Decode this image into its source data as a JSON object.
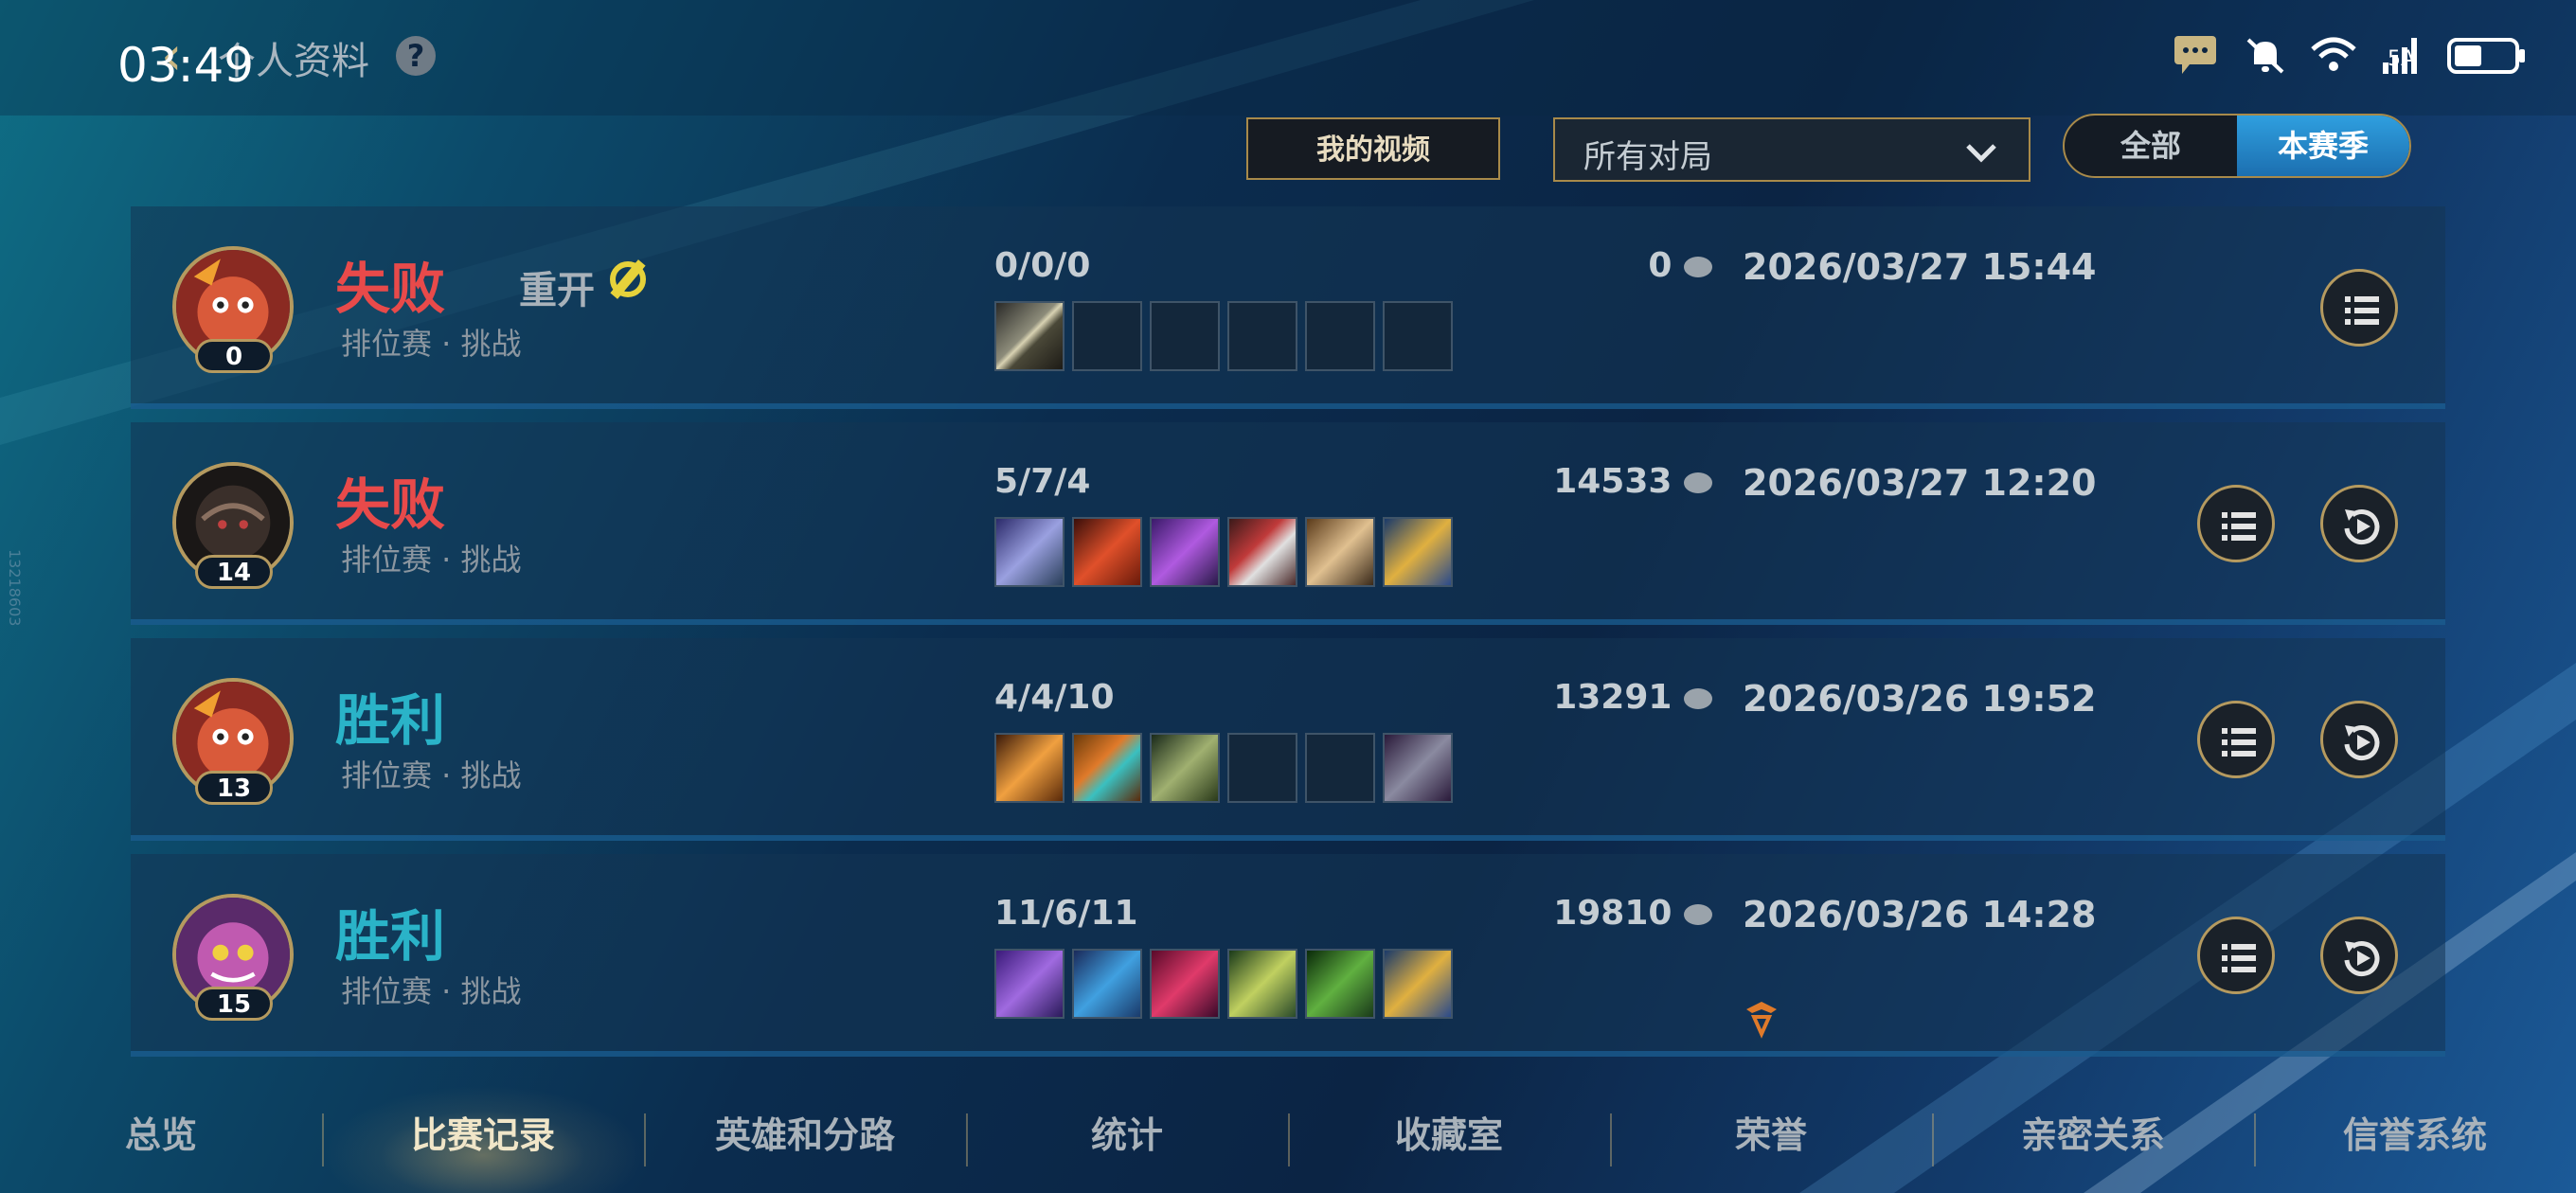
{
  "status_bar": {
    "time": "03:49",
    "network_label": "5A"
  },
  "header": {
    "title": "个人资料",
    "help_label": "?"
  },
  "toolbar": {
    "video_button": "我的视频",
    "filter_value": "所有对局",
    "season_toggle": [
      "全部",
      "本赛季"
    ],
    "season_active": "本赛季"
  },
  "matches": [
    {
      "result": "失败",
      "remake": "重开",
      "mode": "排位赛 · 挑战",
      "level": "0",
      "kda": "0/0/0",
      "gold": "0",
      "date": "2026/03/27 15:44"
    },
    {
      "result": "失败",
      "mode": "排位赛 · 挑战",
      "level": "14",
      "kda": "5/7/4",
      "gold": "14533",
      "date": "2026/03/27 12:20"
    },
    {
      "result": "胜利",
      "mode": "排位赛 · 挑战",
      "level": "13",
      "kda": "4/4/10",
      "gold": "13291",
      "date": "2026/03/26 19:52"
    },
    {
      "result": "胜利",
      "mode": "排位赛 · 挑战",
      "level": "15",
      "kda": "11/6/11",
      "gold": "19810",
      "date": "2026/03/26 14:28"
    }
  ],
  "tabs": [
    "总览",
    "比赛记录",
    "英雄和分路",
    "统计",
    "收藏室",
    "荣誉",
    "亲密关系",
    "信誉系统"
  ],
  "active_tab": "比赛记录",
  "side_id": "13218603",
  "colors": {
    "lose": "#e84a4a",
    "win": "#2ab3c8",
    "gold_border": "#a88a4a",
    "toggle_active": "#2f9fdf"
  }
}
